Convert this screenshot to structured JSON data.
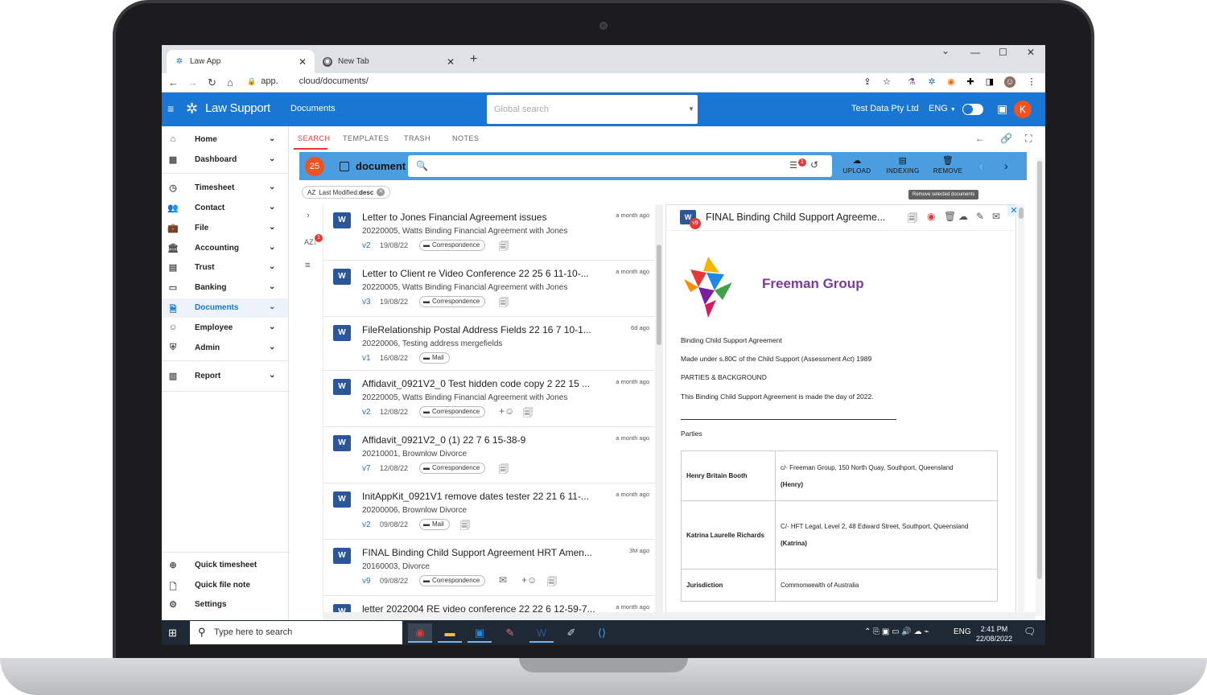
{
  "browser": {
    "tabs": [
      {
        "label": "Law App",
        "icon": "law-app-favicon"
      },
      {
        "label": "New Tab",
        "icon": "chrome-favicon"
      }
    ],
    "new_tab": "+",
    "url_prefix": "app.",
    "url_suffix": "cloud/documents/",
    "window_controls": [
      "⌄",
      "—",
      "☐",
      "✕"
    ]
  },
  "app": {
    "brand": "Law Support",
    "page": "Documents",
    "global_search_placeholder": "Global search",
    "company": "Test Data Pty Ltd",
    "language": "ENG",
    "user_initial": "K",
    "brand_color": "#1976d2"
  },
  "sidebar": {
    "items": [
      {
        "label": "Home",
        "icon": "home-icon",
        "glyph": "⌂"
      },
      {
        "label": "Dashboard",
        "icon": "dashboard-icon",
        "glyph": "▦"
      },
      {
        "label": "Timesheet",
        "icon": "stopwatch-icon",
        "glyph": "◷"
      },
      {
        "label": "Contact",
        "icon": "people-icon",
        "glyph": "👥"
      },
      {
        "label": "File",
        "icon": "briefcase-icon",
        "glyph": "💼"
      },
      {
        "label": "Accounting",
        "icon": "bank-icon",
        "glyph": "🏛"
      },
      {
        "label": "Trust",
        "icon": "building-icon",
        "glyph": "▤"
      },
      {
        "label": "Banking",
        "icon": "card-icon",
        "glyph": "▭"
      },
      {
        "label": "Documents",
        "icon": "document-icon",
        "glyph": "🗎"
      },
      {
        "label": "Employee",
        "icon": "smiley-icon",
        "glyph": "☺"
      },
      {
        "label": "Admin",
        "icon": "shield-icon",
        "glyph": "⛨"
      },
      {
        "label": "Report",
        "icon": "chart-icon",
        "glyph": "▥"
      }
    ],
    "bottom": [
      {
        "label": "Quick timesheet",
        "icon": "timer-plus-icon",
        "glyph": "⊕"
      },
      {
        "label": "Quick file note",
        "icon": "note-plus-icon",
        "glyph": "🗋"
      },
      {
        "label": "Settings",
        "icon": "gear-icon",
        "glyph": "⚙"
      }
    ]
  },
  "content_tabs": [
    "SEARCH",
    "TEMPLATES",
    "TRASH",
    "NOTES"
  ],
  "toolbar": {
    "count": "25",
    "title": "document",
    "filter_badge": "1",
    "upload": "UPLOAD",
    "indexing": "INDEXING",
    "remove": "REMOVE",
    "tooltip": "Remove selected documents"
  },
  "sort_chip": {
    "prefix": "Last Modified:",
    "value": "desc",
    "icon_text": "AZ"
  },
  "rail_badge": "1",
  "documents": [
    {
      "title": "Letter to Jones Financial Agreement issues",
      "ago": "a month ago",
      "matter": "20220005, Watts Binding Financial Agreement with Jones",
      "version": "v2",
      "date": "19/08/22",
      "tag": "Correspondence"
    },
    {
      "title": "Letter to Client re Video Conference 22 25 6 11-10-...",
      "ago": "a month ago",
      "matter": "20220005, Watts Binding Financial Agreement with Jones",
      "version": "v3",
      "date": "19/08/22",
      "tag": "Correspondence"
    },
    {
      "title": "FileRelationship Postal Address Fields 22 16 7 10-1...",
      "ago": "6d ago",
      "matter": "20220006, Testing address mergefields",
      "version": "v1",
      "date": "16/08/22",
      "tag": "Mail"
    },
    {
      "title": "Affidavit_0921V2_0 Test hidden code copy 2 22 15 ...",
      "ago": "a month ago",
      "matter": "20220005, Watts Binding Financial Agreement with Jones",
      "version": "v2",
      "date": "12/08/22",
      "tag": "Correspondence"
    },
    {
      "title": "Affidavit_0921V2_0 (1) 22 7 6 15-38-9",
      "ago": "a month ago",
      "matter": "20210001, Brownlow Divorce",
      "version": "v7",
      "date": "12/08/22",
      "tag": "Correspondence"
    },
    {
      "title": "InitAppKit_0921V1 remove dates tester 22 21 6 11-...",
      "ago": "a month ago",
      "matter": "20200006, Brownlow Divorce",
      "version": "v2",
      "date": "09/08/22",
      "tag": "Mail"
    },
    {
      "title": "FINAL Binding Child Support Agreement HRT Amen...",
      "ago": "3M ago",
      "matter": "20160003, Divorce",
      "version": "v9",
      "date": "09/08/22",
      "tag": "Correspondence"
    },
    {
      "title": "letter 2022004 RE video conference 22 22 6 12-59-7...",
      "ago": "a month ago",
      "matter": "",
      "version": "",
      "date": "",
      "tag": ""
    }
  ],
  "preview": {
    "title": "FINAL Binding Child Support Agreeme...",
    "version_badge": "v9",
    "org": "Freeman Group",
    "lines": [
      "Binding Child Support Agreement",
      "Made under s.80C of the Child Support (Assessment Act) 1989",
      "PARTIES & BACKGROUND",
      "This Binding Child Support Agreement is made the day of 2022."
    ],
    "parties_heading": "Parties",
    "table": [
      {
        "k": "Henry Britain Booth",
        "v1": "c/- Freeman Group, 150 North Quay, Southport, Queensland",
        "v2": "(Henry)"
      },
      {
        "k": "Katrina Laurelle Richards",
        "v1": "C/- HFT Legal, Level 2, 48 Edward Street, Southport, Queensland",
        "v2": "(Katrina)"
      },
      {
        "k": "Jurisdiction",
        "v1": "Commonwealth of Australia",
        "v2": ""
      }
    ]
  },
  "taskbar": {
    "search_placeholder": "Type here to search",
    "language": "ENG",
    "time": "2:41 PM",
    "date": "22/08/2022"
  }
}
